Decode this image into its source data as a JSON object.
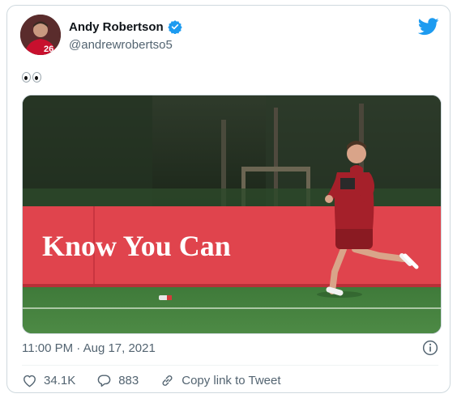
{
  "author": {
    "display_name": "Andy Robertson",
    "handle": "@andrewrobertso5",
    "verified": true
  },
  "tweet": {
    "text_emoji": "eyes-emoji",
    "image_banner_text": "Know You Can",
    "timestamp": "11:00 PM · Aug 17, 2021"
  },
  "actions": {
    "likes": "34.1K",
    "replies": "883",
    "copy_link_label": "Copy link to Tweet"
  },
  "colors": {
    "twitter_blue": "#1d9bf0",
    "banner_red": "#e0444d",
    "text_primary": "#0f1419",
    "text_secondary": "#536471"
  }
}
